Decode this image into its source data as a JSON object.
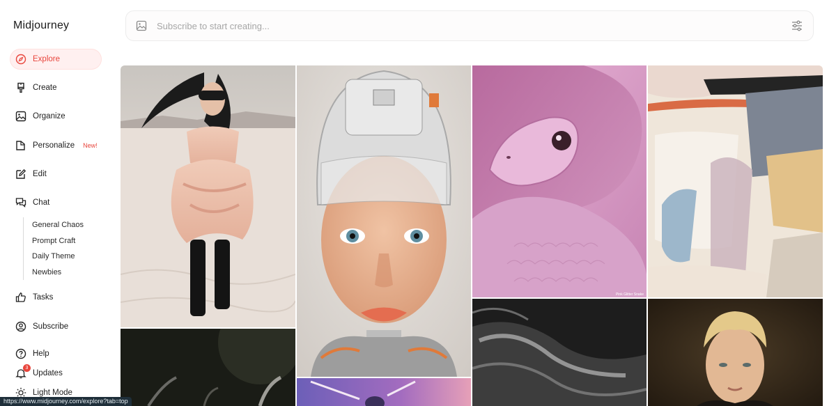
{
  "app": {
    "logo": "Midjourney"
  },
  "nav": {
    "explore": "Explore",
    "create": "Create",
    "organize": "Organize",
    "personalize": "Personalize",
    "personalize_badge": "New!",
    "edit": "Edit",
    "chat": "Chat",
    "chat_rooms": [
      "General Chaos",
      "Prompt Craft",
      "Daily Theme",
      "Newbies"
    ],
    "tasks": "Tasks",
    "subscribe": "Subscribe",
    "help": "Help",
    "updates": "Updates",
    "updates_count": "3",
    "light_mode": "Light Mode"
  },
  "search": {
    "placeholder": "Subscribe to start creating..."
  },
  "gallery": {
    "images": [
      {
        "subject": "woman in pink tulle dress in desert"
      },
      {
        "subject": "freckled girl in robotic helmet"
      },
      {
        "subject": "pink glitter snake",
        "caption": "Pink Glitter Snake"
      },
      {
        "subject": "abstract pastel painting"
      },
      {
        "subject": "dark horned creature"
      },
      {
        "subject": "purple sky with planet"
      },
      {
        "subject": "black and white fur close-up"
      },
      {
        "subject": "portrait of blond young man"
      }
    ]
  },
  "status_bar": {
    "url": "https://www.midjourney.com/explore?tab=top"
  },
  "colors": {
    "accent": "#e8453c",
    "active_bg": "#fff0f0"
  }
}
